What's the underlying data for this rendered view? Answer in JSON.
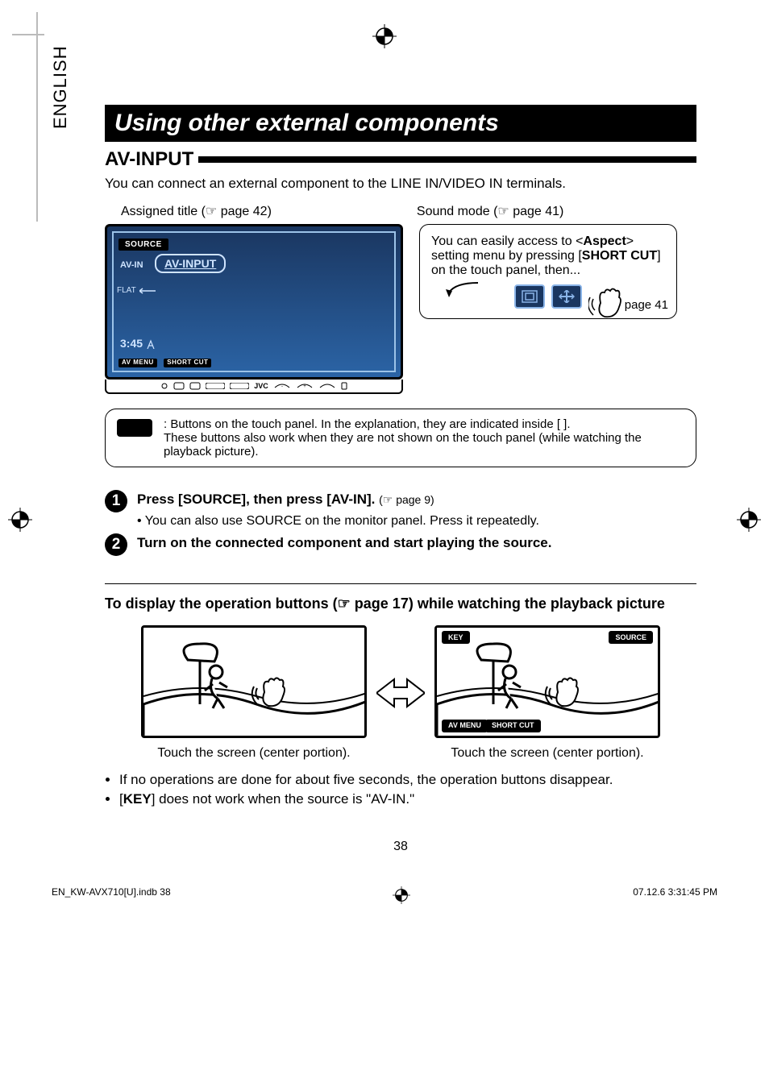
{
  "language_tab": "ENGLISH",
  "title": "Using other external components",
  "section_heading": "AV-INPUT",
  "intro": "You can connect an external component to the LINE IN/VIDEO IN terminals.",
  "callouts": {
    "assigned_title": "Assigned title (☞ page 42)",
    "sound_mode": "Sound mode (☞ page 41)"
  },
  "device_screen": {
    "source_btn": "SOURCE",
    "avin_label": "AV-IN",
    "title_box": "AV-INPUT",
    "flat": "FLAT",
    "clock": "3:45",
    "av_menu": "AV MENU",
    "short_cut": "SHORT CUT",
    "brand": "JVC"
  },
  "tip_box": {
    "text_parts": {
      "p1": "You can easily access to <",
      "aspect": "Aspect",
      "p2": "> setting menu by pressing [",
      "shortcut": "SHORT CUT",
      "p3": "] on the touch panel, then..."
    },
    "page_ref": "☞ page 41"
  },
  "note_box": {
    "line1": ":   Buttons on the touch panel. In the explanation, they are indicated inside [       ].",
    "line2": "These buttons also work when they are not shown on the touch panel (while watching the playback picture)."
  },
  "steps": {
    "s1": {
      "num": "1",
      "main": "Press [SOURCE], then press [AV-IN].",
      "ref": "(☞ page 9)",
      "sub": "•  You can also use SOURCE on the monitor panel. Press it repeatedly."
    },
    "s2": {
      "num": "2",
      "main": "Turn on the connected component and start playing the source."
    }
  },
  "sub_heading": "To display the operation buttons (☞ page 17) while watching the playback picture",
  "playback": {
    "caption_left": "Touch the screen (center portion).",
    "caption_right": "Touch the screen (center portion).",
    "labels": {
      "key": "KEY",
      "source": "SOURCE",
      "av_menu": "AV MENU",
      "short_cut": "SHORT CUT"
    }
  },
  "bullets": {
    "b1": "If no operations are done for about five seconds, the operation buttons disappear.",
    "b2_pre": "[",
    "b2_key": "KEY",
    "b2_post": "] does not work when the source is \"AV-IN.\""
  },
  "page_number": "38",
  "footer": {
    "left": "EN_KW-AVX710[U].indb   38",
    "right": "07.12.6   3:31:45 PM"
  }
}
